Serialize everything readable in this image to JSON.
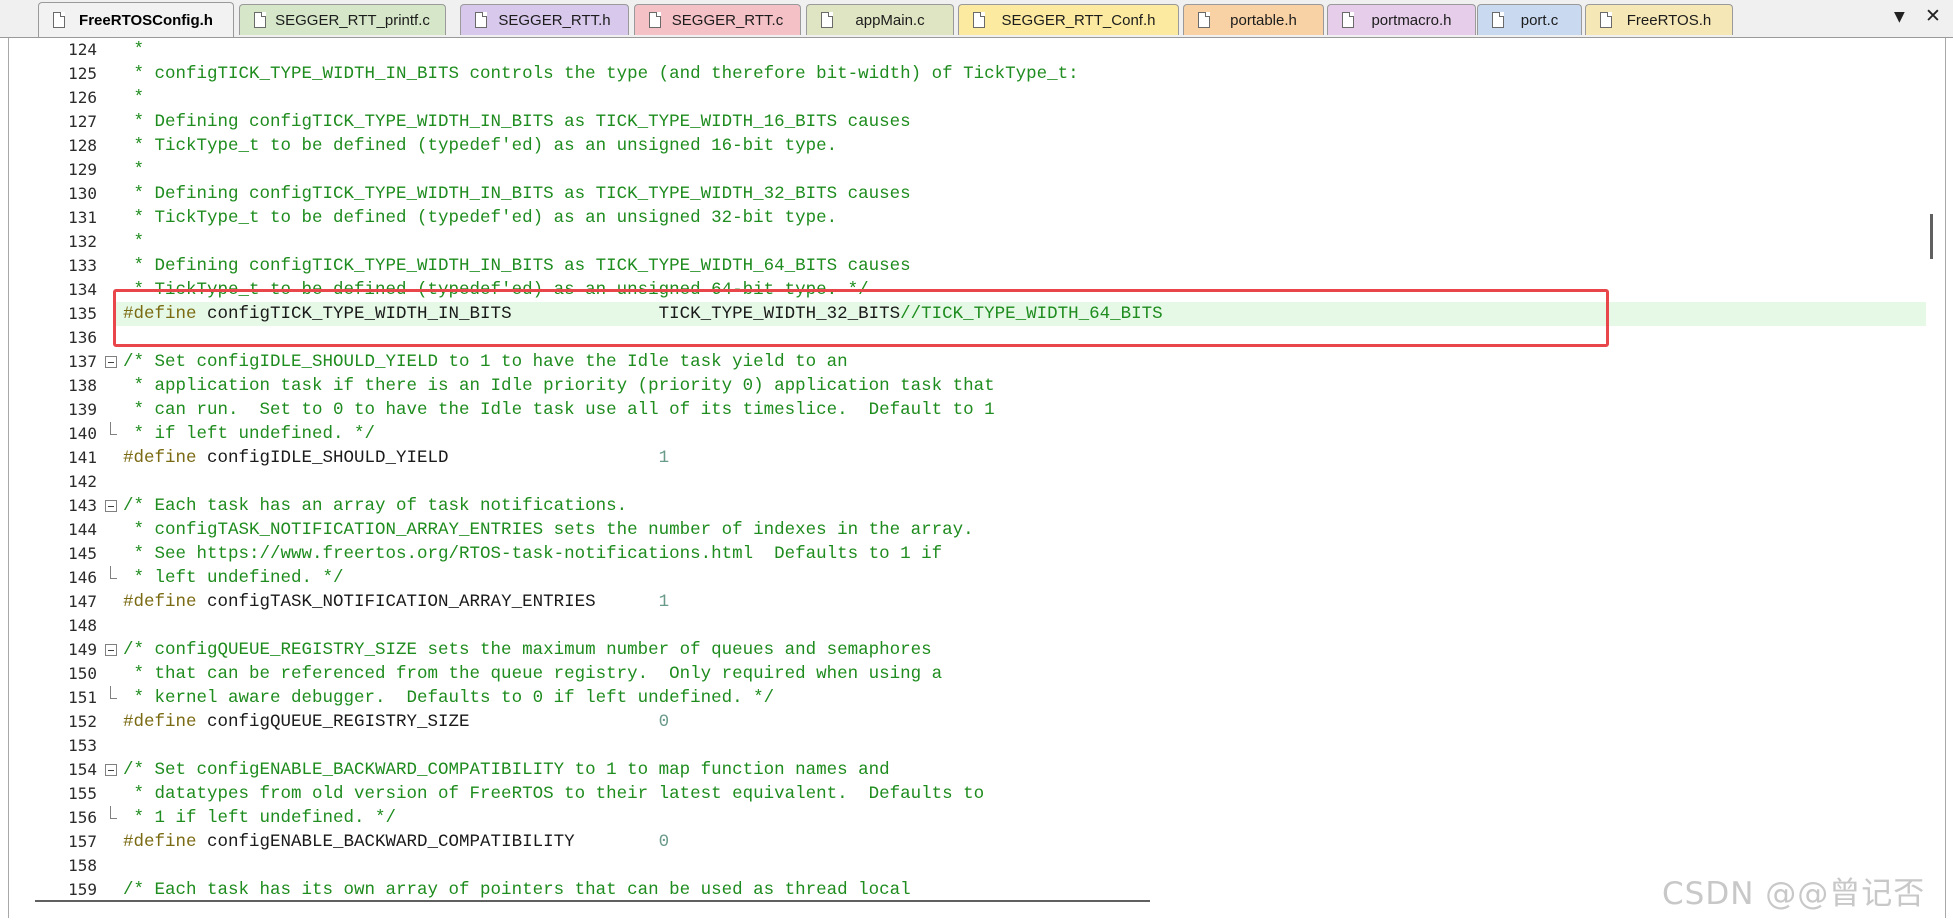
{
  "tabs": [
    {
      "label": "FreeRTOSConfig.h",
      "color": "#f2f2f2",
      "active": true
    },
    {
      "label": "SEGGER_RTT_printf.c",
      "color": "#d6e7c9",
      "active": false
    },
    {
      "label": "SEGGER_RTT.h",
      "color": "#d7c8ec",
      "active": false
    },
    {
      "label": "SEGGER_RTT.c",
      "color": "#f4c1c6",
      "active": false
    },
    {
      "label": "appMain.c",
      "color": "#dfe5c2",
      "active": false
    },
    {
      "label": "SEGGER_RTT_Conf.h",
      "color": "#fbeaa0",
      "active": false
    },
    {
      "label": "portable.h",
      "color": "#f8d2a5",
      "active": false
    },
    {
      "label": "portmacro.h",
      "color": "#e6cdea",
      "active": false
    },
    {
      "label": "port.c",
      "color": "#c9daf0",
      "active": false
    },
    {
      "label": "FreeRTOS.h",
      "color": "#f5e7b6",
      "active": false
    }
  ],
  "tab_dropdown_icon": "▼",
  "tab_close_icon": "✕",
  "lines": [
    {
      "n": "124",
      "fold": "",
      "segs": [
        [
          "c",
          " *"
        ]
      ]
    },
    {
      "n": "125",
      "fold": "",
      "segs": [
        [
          "c",
          " * configTICK_TYPE_WIDTH_IN_BITS controls the type (and therefore bit-width) of TickType_t:"
        ]
      ]
    },
    {
      "n": "126",
      "fold": "",
      "segs": [
        [
          "c",
          " *"
        ]
      ]
    },
    {
      "n": "127",
      "fold": "",
      "segs": [
        [
          "c",
          " * Defining configTICK_TYPE_WIDTH_IN_BITS as TICK_TYPE_WIDTH_16_BITS causes"
        ]
      ]
    },
    {
      "n": "128",
      "fold": "",
      "segs": [
        [
          "c",
          " * TickType_t to be defined (typedef'ed) as an unsigned 16-bit type."
        ]
      ]
    },
    {
      "n": "129",
      "fold": "",
      "segs": [
        [
          "c",
          " *"
        ]
      ]
    },
    {
      "n": "130",
      "fold": "",
      "segs": [
        [
          "c",
          " * Defining configTICK_TYPE_WIDTH_IN_BITS as TICK_TYPE_WIDTH_32_BITS causes"
        ]
      ]
    },
    {
      "n": "131",
      "fold": "",
      "segs": [
        [
          "c",
          " * TickType_t to be defined (typedef'ed) as an unsigned 32-bit type."
        ]
      ]
    },
    {
      "n": "132",
      "fold": "",
      "segs": [
        [
          "c",
          " *"
        ]
      ]
    },
    {
      "n": "133",
      "fold": "",
      "segs": [
        [
          "c",
          " * Defining configTICK_TYPE_WIDTH_IN_BITS as TICK_TYPE_WIDTH_64_BITS causes"
        ]
      ]
    },
    {
      "n": "134",
      "fold": "",
      "segs": [
        [
          "c",
          " * TickType_t to be defined (typedef'ed) as an unsigned 64-bit type. */"
        ]
      ]
    },
    {
      "n": "135",
      "fold": "",
      "highlight": true,
      "segs": [
        [
          "p",
          "#define "
        ],
        [
          "i",
          "configTICK_TYPE_WIDTH_IN_BITS              TICK_TYPE_WIDTH_32_BITS"
        ],
        [
          "c",
          "//TICK_TYPE_WIDTH_64_BITS"
        ]
      ]
    },
    {
      "n": "136",
      "fold": "",
      "segs": []
    },
    {
      "n": "137",
      "fold": "start",
      "segs": [
        [
          "c",
          "/* Set configIDLE_SHOULD_YIELD to 1 to have the Idle task yield to an"
        ]
      ]
    },
    {
      "n": "138",
      "fold": "",
      "segs": [
        [
          "c",
          " * application task if there is an Idle priority (priority 0) application task that"
        ]
      ]
    },
    {
      "n": "139",
      "fold": "",
      "segs": [
        [
          "c",
          " * can run.  Set to 0 to have the Idle task use all of its timeslice.  Default to 1"
        ]
      ]
    },
    {
      "n": "140",
      "fold": "end",
      "segs": [
        [
          "c",
          " * if left undefined. */"
        ]
      ]
    },
    {
      "n": "141",
      "fold": "",
      "segs": [
        [
          "p",
          "#define "
        ],
        [
          "i",
          "configIDLE_SHOULD_YIELD                    "
        ],
        [
          "n",
          "1"
        ]
      ]
    },
    {
      "n": "142",
      "fold": "",
      "segs": []
    },
    {
      "n": "143",
      "fold": "start",
      "segs": [
        [
          "c",
          "/* Each task has an array of task notifications."
        ]
      ]
    },
    {
      "n": "144",
      "fold": "",
      "segs": [
        [
          "c",
          " * configTASK_NOTIFICATION_ARRAY_ENTRIES sets the number of indexes in the array."
        ]
      ]
    },
    {
      "n": "145",
      "fold": "",
      "segs": [
        [
          "c",
          " * See https://www.freertos.org/RTOS-task-notifications.html  Defaults to 1 if"
        ]
      ]
    },
    {
      "n": "146",
      "fold": "end",
      "segs": [
        [
          "c",
          " * left undefined. */"
        ]
      ]
    },
    {
      "n": "147",
      "fold": "",
      "segs": [
        [
          "p",
          "#define "
        ],
        [
          "i",
          "configTASK_NOTIFICATION_ARRAY_ENTRIES      "
        ],
        [
          "n",
          "1"
        ]
      ]
    },
    {
      "n": "148",
      "fold": "",
      "segs": []
    },
    {
      "n": "149",
      "fold": "start",
      "segs": [
        [
          "c",
          "/* configQUEUE_REGISTRY_SIZE sets the maximum number of queues and semaphores"
        ]
      ]
    },
    {
      "n": "150",
      "fold": "",
      "segs": [
        [
          "c",
          " * that can be referenced from the queue registry.  Only required when using a"
        ]
      ]
    },
    {
      "n": "151",
      "fold": "end",
      "segs": [
        [
          "c",
          " * kernel aware debugger.  Defaults to 0 if left undefined. */"
        ]
      ]
    },
    {
      "n": "152",
      "fold": "",
      "segs": [
        [
          "p",
          "#define "
        ],
        [
          "i",
          "configQUEUE_REGISTRY_SIZE                  "
        ],
        [
          "n",
          "0"
        ]
      ]
    },
    {
      "n": "153",
      "fold": "",
      "segs": []
    },
    {
      "n": "154",
      "fold": "start",
      "segs": [
        [
          "c",
          "/* Set configENABLE_BACKWARD_COMPATIBILITY to 1 to map function names and"
        ]
      ]
    },
    {
      "n": "155",
      "fold": "",
      "segs": [
        [
          "c",
          " * datatypes from old version of FreeRTOS to their latest equivalent.  Defaults to"
        ]
      ]
    },
    {
      "n": "156",
      "fold": "end",
      "segs": [
        [
          "c",
          " * 1 if left undefined. */"
        ]
      ]
    },
    {
      "n": "157",
      "fold": "",
      "segs": [
        [
          "p",
          "#define "
        ],
        [
          "i",
          "configENABLE_BACKWARD_COMPATIBILITY        "
        ],
        [
          "n",
          "0"
        ]
      ]
    },
    {
      "n": "158",
      "fold": "",
      "segs": []
    },
    {
      "n": "159",
      "fold": "",
      "segs": [
        [
          "c",
          "/* Each task has its own array of pointers that can be used as thread local"
        ]
      ]
    }
  ],
  "watermark": "CSDN @@曾记否"
}
